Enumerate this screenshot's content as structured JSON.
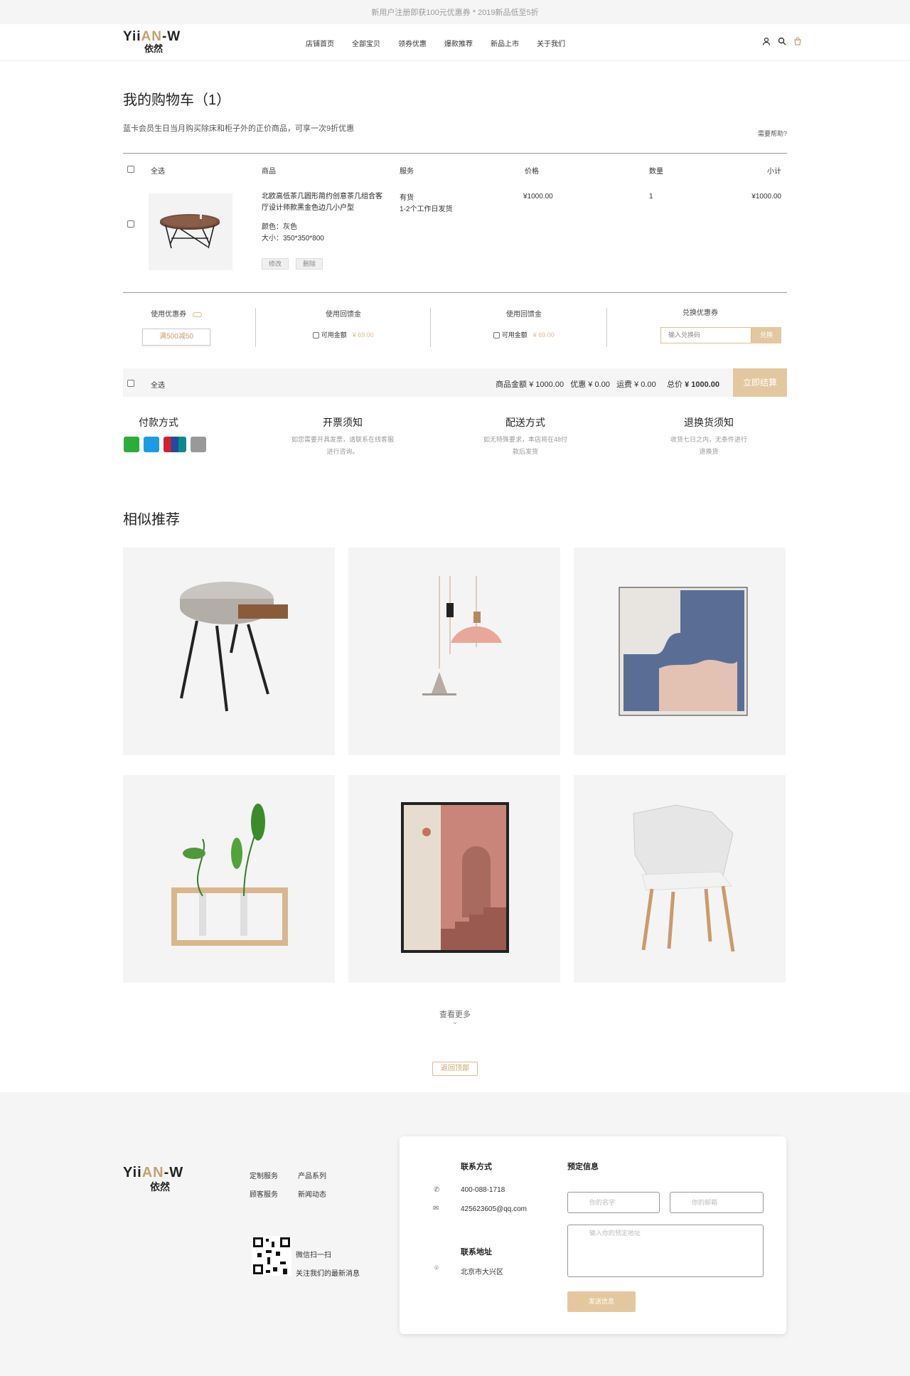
{
  "topbar": {
    "text": "新用户注册即获100元优惠券 * 2019新品低至5折"
  },
  "brand": {
    "en_a": "Yii",
    "en_b": "AN",
    "en_c": "-W",
    "cn": "依然"
  },
  "nav": [
    "店铺首页",
    "全部宝贝",
    "领券优惠",
    "爆款推荐",
    "新品上市",
    "关于我们"
  ],
  "page": {
    "title": "我的购物车（1）",
    "notice": "蓝卡会员生日当月购买除床和柜子外的正价商品，可享一次9折优惠",
    "help": "需要帮助?"
  },
  "cart": {
    "headers": {
      "select_all": "全选",
      "product": "商品",
      "service": "服务",
      "price": "价格",
      "qty": "数量",
      "subtotal": "小计"
    },
    "item": {
      "name": "北欧高低茶几圆形简约创意茶几组合客厅设计师款黑金色边几小户型",
      "color": "颜色：灰色",
      "size": "大小：350*350*800",
      "stock": "有货",
      "ship": "1-2个工作日发货",
      "price": "¥1000.00",
      "qty": "1",
      "subtotal": "¥1000.00",
      "edit": "修改",
      "delete": "删除"
    }
  },
  "coupons": {
    "use_coupon": "使用优惠券",
    "coupon_value": "满500减50",
    "gift_card": "使用回馈金",
    "gift_card_avail": "可用金额",
    "gift_card_amount": "¥ 69.00",
    "rebate": "使用回馈金",
    "rebate_avail": "可用金额",
    "rebate_amount": "¥ 69.00",
    "redeem_title": "兑换优惠券",
    "redeem_placeholder": "输入兑换码",
    "redeem_button": "兑换"
  },
  "summary": {
    "select_all": "全选",
    "goods_label": "商品金额",
    "goods": "¥ 1000.00",
    "discount_label": "优惠",
    "discount": "¥ 0.00",
    "shipping_label": "运费",
    "shipping": "¥ 0.00",
    "total_label": "总价",
    "total": "¥ 1000.00",
    "checkout": "立即结算"
  },
  "info": [
    {
      "title": "付款方式",
      "desc": ""
    },
    {
      "title": "开票须知",
      "desc": "如您需要开具发票，请联系在线客服进行咨询。"
    },
    {
      "title": "配送方式",
      "desc": "如无特殊要求，本店将在48付款后发货"
    },
    {
      "title": "退换货须知",
      "desc": "收货七日之内，无条件进行退换货"
    }
  ],
  "recommend": {
    "title": "相似推荐",
    "more": "查看更多",
    "back_top": "返回顶部"
  },
  "footer": {
    "links": [
      "定制服务",
      "产品系列",
      "顾客服务",
      "新闻动态"
    ],
    "qr_line1": "微信扫一扫",
    "qr_line2": "关注我们的最新消息",
    "contact_title": "联系方式",
    "phone": "400-088-1718",
    "email": "425623605@qq.com",
    "address_title": "联系地址",
    "address": "北京市大兴区",
    "booking_title": "预定信息",
    "name_placeholder": "你的名字",
    "email_placeholder": "你的邮箱",
    "address_placeholder": "输入你的预定地址",
    "send": "发送信息"
  },
  "colors": {
    "accent": "#e3c89f",
    "accent_text": "#c8a06a"
  }
}
